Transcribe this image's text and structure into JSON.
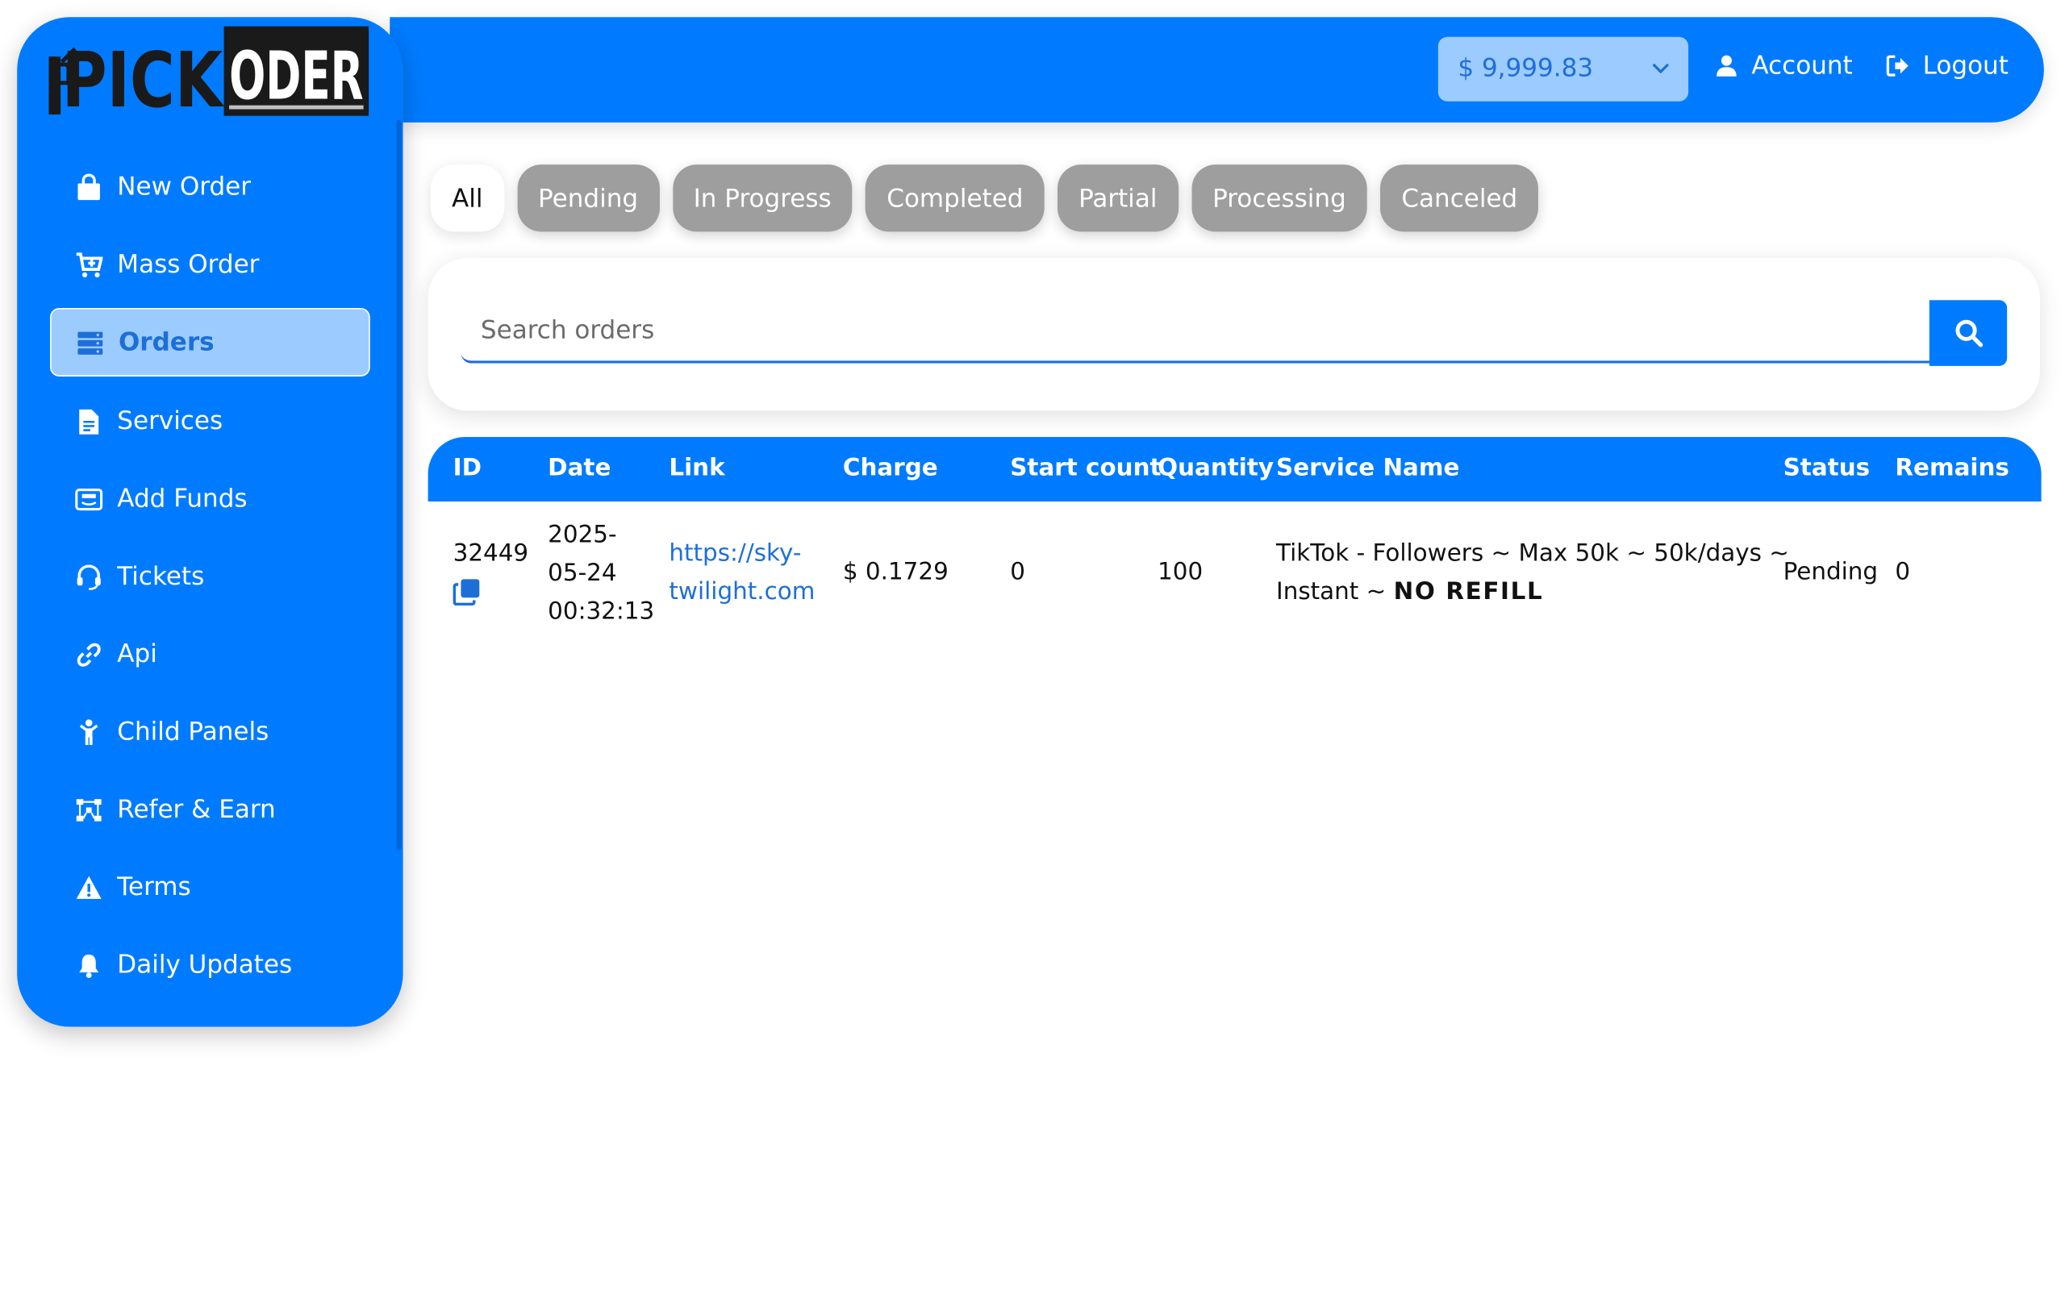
{
  "header": {
    "balance": "$ 9,999.83",
    "account_label": "Account",
    "logout_label": "Logout"
  },
  "brand": {
    "name_part1": "PICK",
    "name_part2": "ODER"
  },
  "sidebar": {
    "items": [
      {
        "label": "New Order",
        "icon": "shopping-bag-icon"
      },
      {
        "label": "Mass Order",
        "icon": "cart-plus-icon"
      },
      {
        "label": "Orders",
        "icon": "server-list-icon",
        "active": true
      },
      {
        "label": "Services",
        "icon": "file-document-icon"
      },
      {
        "label": "Add Funds",
        "icon": "payment-card-icon"
      },
      {
        "label": "Tickets",
        "icon": "headset-icon"
      },
      {
        "label": "Api",
        "icon": "link-icon"
      },
      {
        "label": "Child Panels",
        "icon": "child-icon"
      },
      {
        "label": "Refer & Earn",
        "icon": "network-icon"
      },
      {
        "label": "Terms",
        "icon": "warning-icon"
      },
      {
        "label": "Daily Updates",
        "icon": "bell-icon"
      }
    ]
  },
  "filters": {
    "tabs": [
      "All",
      "Pending",
      "In Progress",
      "Completed",
      "Partial",
      "Processing",
      "Canceled"
    ],
    "active": "All"
  },
  "search": {
    "placeholder": "Search orders"
  },
  "table": {
    "headers": [
      "ID",
      "Date",
      "Link",
      "Charge",
      "Start count",
      "Quantity",
      "Service Name",
      "Status",
      "Remains"
    ],
    "rows": [
      {
        "id": "32449",
        "date_line1": "2025-",
        "date_line2": "05-24",
        "date_line3": "00:32:13",
        "link_line1": "https://sky-",
        "link_line2": "twilight.com",
        "charge": "$ 0.1729",
        "start_count": "0",
        "quantity": "100",
        "service_line1": "TikTok - Followers ~ Max 50k ~ 50k/days ~",
        "service_line2": "Instant ~ ",
        "service_tag": "NO REFILL",
        "status": "Pending",
        "remains": "0"
      }
    ]
  },
  "colors": {
    "primary": "#007bff",
    "active_bg": "#9ccbff",
    "active_text": "#1d6fd8",
    "tab_inactive": "#9e9e9e"
  }
}
